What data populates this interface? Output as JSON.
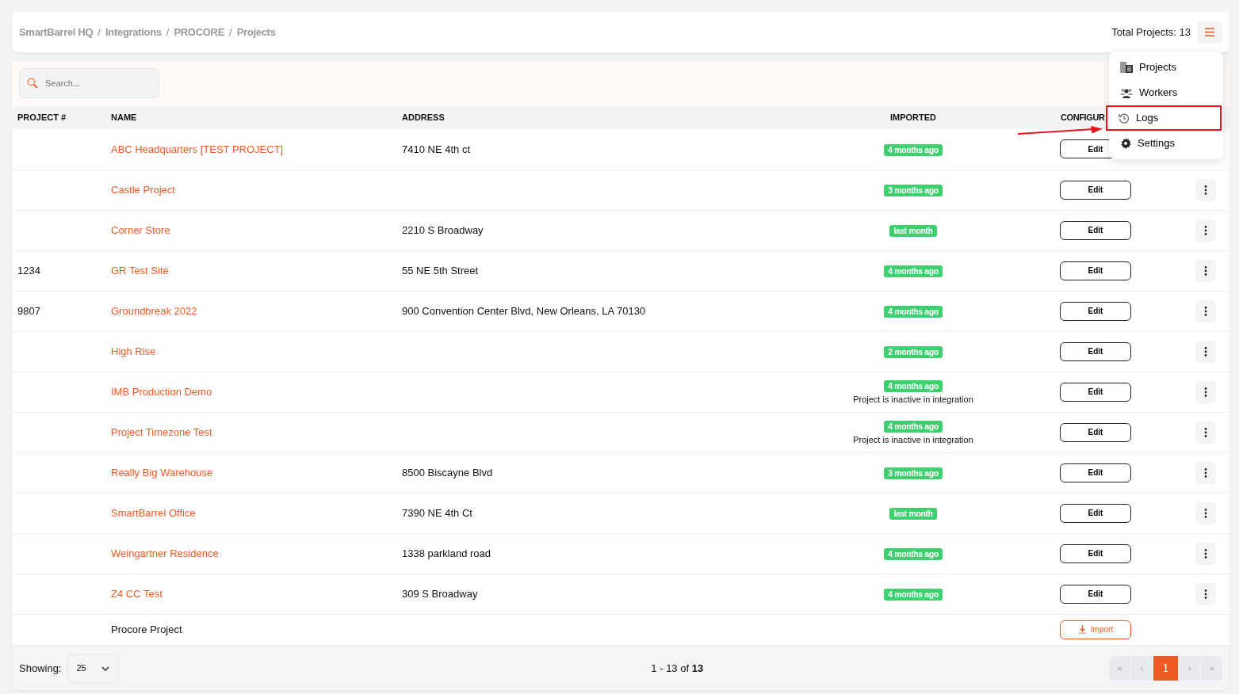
{
  "breadcrumb": [
    "SmartBarrel HQ",
    "Integrations",
    "PROCORE",
    "Projects"
  ],
  "breadcrumb_separator": "/",
  "total_projects": "Total Projects: 13",
  "menu": {
    "items": [
      {
        "label": "Projects",
        "kind": "building",
        "highlighted": false
      },
      {
        "label": "Workers",
        "kind": "people",
        "highlighted": false
      },
      {
        "label": "Logs",
        "kind": "history",
        "highlighted": true
      },
      {
        "label": "Settings",
        "kind": "gear",
        "highlighted": false
      }
    ]
  },
  "search": {
    "placeholder": "Search..."
  },
  "table": {
    "columns": [
      "PROJECT #",
      "NAME",
      "ADDRESS",
      "IMPORTED",
      "CONFIGUR"
    ],
    "rows": [
      {
        "kind": "project",
        "name": "ABC Headquarters [TEST PROJECT]",
        "address": "7410 NE 4th ct",
        "imported": "4 months ago",
        "action": "Edit",
        "more": false
      },
      {
        "kind": "project",
        "name": "Castle Project",
        "imported": "3 months ago",
        "action": "Edit",
        "more": true
      },
      {
        "kind": "project",
        "name": "Corner Store",
        "address": "2210 S Broadway",
        "imported": "last month",
        "action": "Edit",
        "more": true
      },
      {
        "kind": "project",
        "number": "1234",
        "name": "GR Test Site",
        "address": "55 NE 5th Street",
        "imported": "4 months ago",
        "action": "Edit",
        "more": true
      },
      {
        "kind": "project",
        "number": "9807",
        "name": "Groundbreak 2022",
        "address": "900 Convention Center Blvd, New Orleans, LA 70130",
        "imported": "4 months ago",
        "action": "Edit",
        "more": true
      },
      {
        "kind": "project",
        "name": "High Rise",
        "imported": "2 months ago",
        "action": "Edit",
        "more": true
      },
      {
        "kind": "project",
        "name": "IMB Production Demo",
        "imported": "4 months ago",
        "note": "Project is inactive in integration",
        "action": "Edit",
        "more": true
      },
      {
        "kind": "project",
        "name": "Project Timezone Test",
        "imported": "4 months ago",
        "note": "Project is inactive in integration",
        "action": "Edit",
        "more": true
      },
      {
        "kind": "project",
        "name": "Really Big Warehouse",
        "address": "8500 Biscayne Blvd",
        "imported": "3 months ago",
        "action": "Edit",
        "more": true
      },
      {
        "kind": "project",
        "name": "SmartBarrel Office",
        "address": "7390 NE 4th Ct",
        "imported": "last month",
        "action": "Edit",
        "more": true
      },
      {
        "kind": "project",
        "name": "Weingartner Residence",
        "address": "1338 parkland road",
        "imported": "4 months ago",
        "action": "Edit",
        "more": true
      },
      {
        "kind": "project",
        "name": "Z4 CC Test",
        "address": "309 S Broadway",
        "imported": "4 months ago",
        "action": "Edit",
        "more": true
      },
      {
        "kind": "import",
        "name": "Procore Project",
        "action": "Import"
      }
    ]
  },
  "footer": {
    "showing_label": "Showing:",
    "page_size": "25",
    "range": "1 - 13 of **13**",
    "pages": [
      {
        "label": "«",
        "selected": false
      },
      {
        "label": "‹",
        "selected": false
      },
      {
        "label": "1",
        "selected": true
      },
      {
        "label": "›",
        "selected": false
      },
      {
        "label": "»",
        "selected": false
      }
    ]
  }
}
